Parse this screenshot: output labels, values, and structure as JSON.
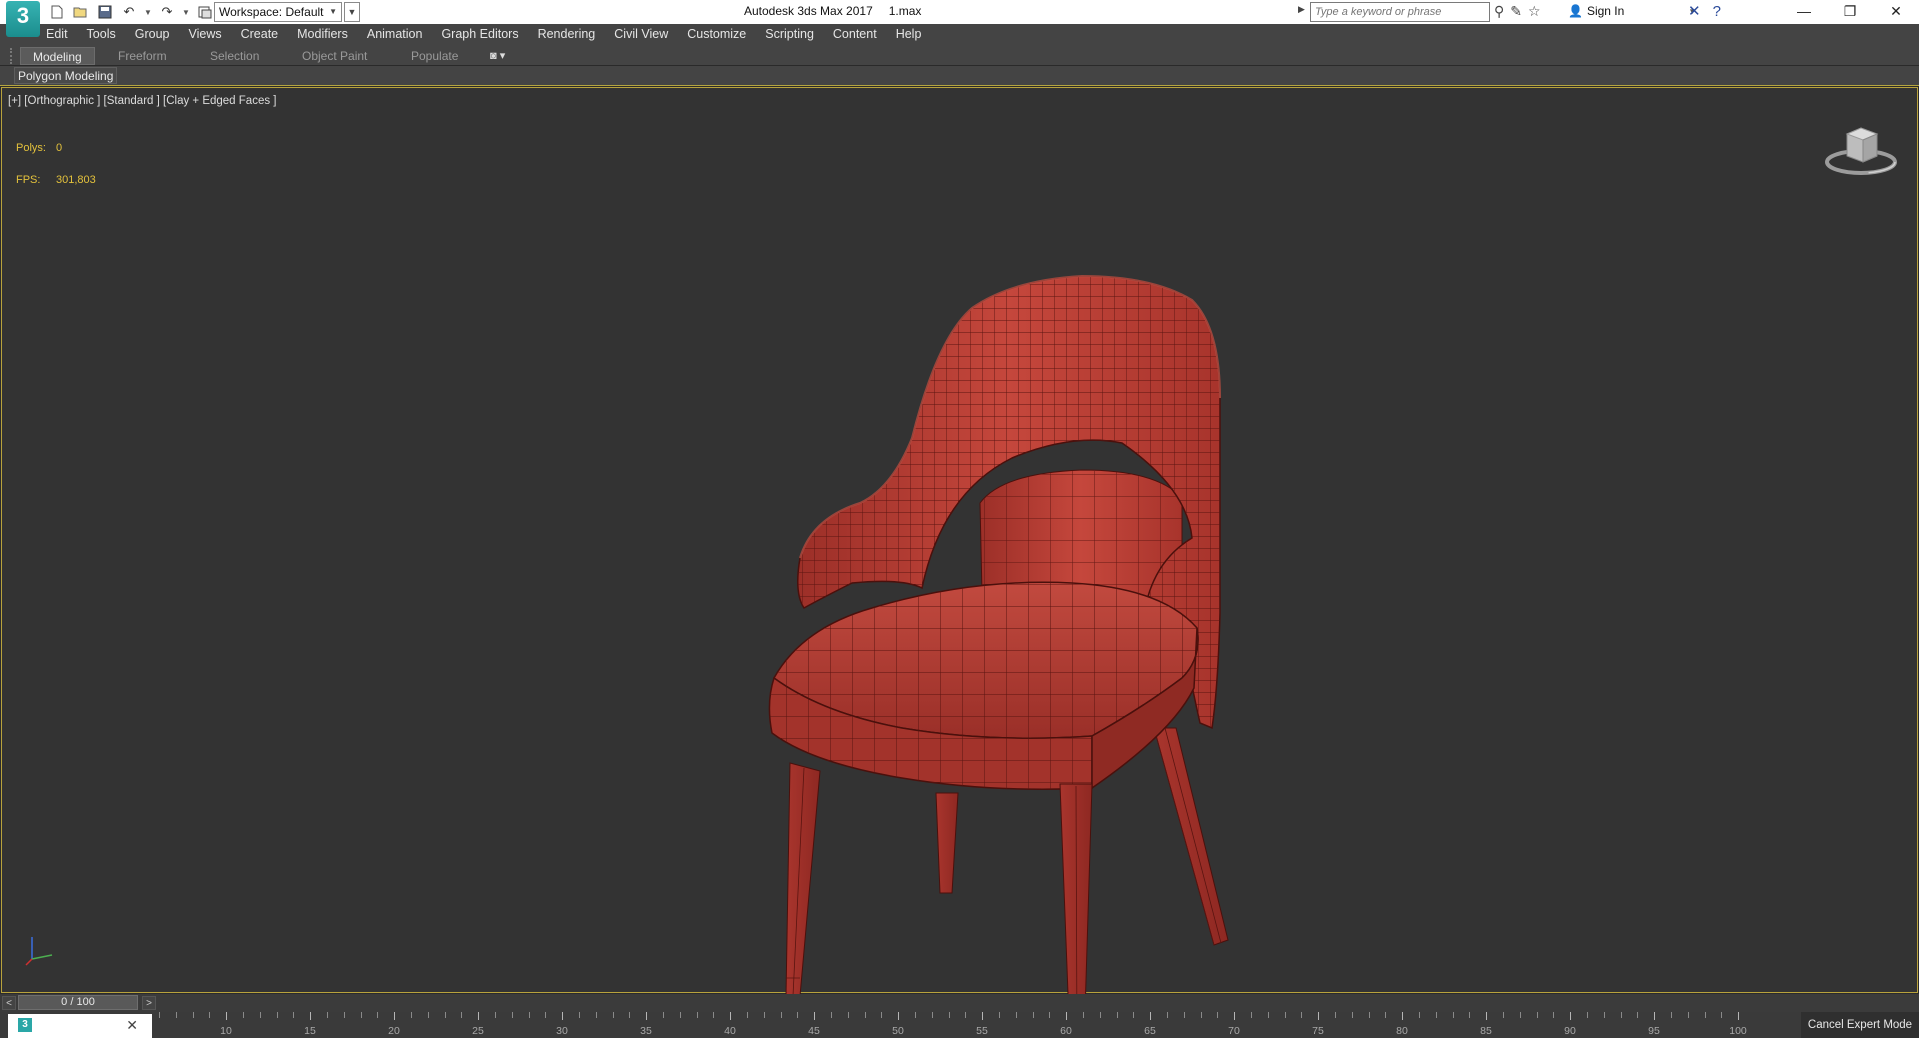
{
  "app": {
    "logo_text": "3",
    "title": "Autodesk 3ds Max 2017",
    "file": "1.max",
    "workspace": "Workspace: Default"
  },
  "search": {
    "placeholder": "Type a keyword or phrase"
  },
  "account": {
    "sign_in": "Sign In"
  },
  "menu": [
    "Edit",
    "Tools",
    "Group",
    "Views",
    "Create",
    "Modifiers",
    "Animation",
    "Graph Editors",
    "Rendering",
    "Civil View",
    "Customize",
    "Scripting",
    "Content",
    "Help"
  ],
  "ribbon": {
    "tabs": [
      "Modeling",
      "Freeform",
      "Selection",
      "Object Paint",
      "Populate"
    ],
    "active_tab": "Modeling",
    "panel_label": "Polygon Modeling"
  },
  "viewport": {
    "label": "[+] [Orthographic ] [Standard ] [Clay + Edged Faces ]",
    "stats": {
      "polys_label": "Polys:",
      "polys_value": "0",
      "fps_label": "FPS:",
      "fps_value": "301,803"
    },
    "object_color": "#b13b32",
    "background_color": "#333333",
    "border_color": "#b8a23c"
  },
  "timeline": {
    "frame_display": "0 / 100",
    "ticks": [
      "10",
      "15",
      "20",
      "25",
      "30",
      "35",
      "40",
      "45",
      "50",
      "55",
      "60",
      "65",
      "70",
      "75",
      "80",
      "85",
      "90",
      "95",
      "100"
    ]
  },
  "status": {
    "cancel_expert": "Cancel Expert Mode"
  }
}
